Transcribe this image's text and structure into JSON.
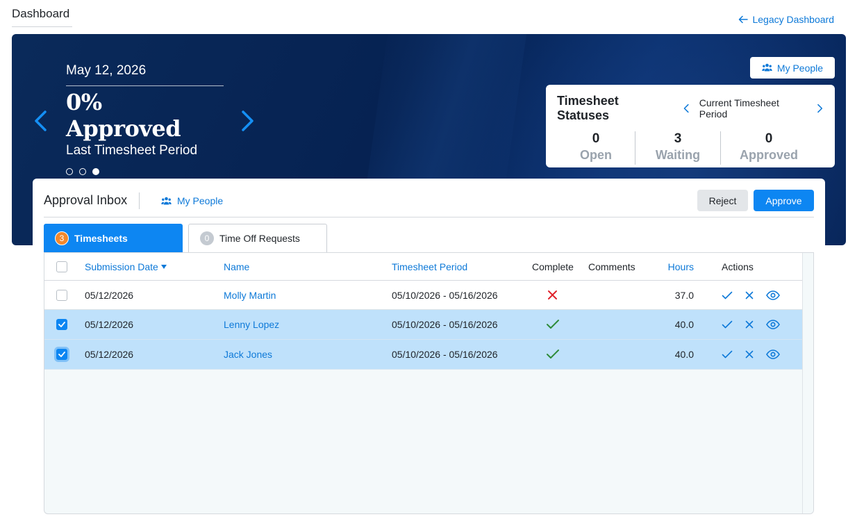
{
  "page": {
    "title": "Dashboard",
    "legacy_link": "Legacy Dashboard"
  },
  "banner": {
    "date": "May 12, 2026",
    "metric": "0% Approved",
    "caption": "Last Timesheet Period",
    "dots_count": 3,
    "active_dot": 3,
    "my_people_label": "My People"
  },
  "status_card": {
    "title": "Timesheet Statuses",
    "period_label": "Current Timesheet Period",
    "stats": [
      {
        "value": "0",
        "label": "Open"
      },
      {
        "value": "3",
        "label": "Waiting"
      },
      {
        "value": "0",
        "label": "Approved"
      }
    ]
  },
  "inbox": {
    "title": "Approval Inbox",
    "my_people_label": "My People",
    "reject_label": "Reject",
    "approve_label": "Approve",
    "tabs": [
      {
        "label": "Timesheets",
        "count": "3",
        "active": true
      },
      {
        "label": "Time Off Requests",
        "count": "0",
        "active": false
      }
    ],
    "columns": {
      "submission_date": "Submission Date",
      "name": "Name",
      "period": "Timesheet Period",
      "complete": "Complete",
      "comments": "Comments",
      "hours": "Hours",
      "actions": "Actions"
    },
    "rows": [
      {
        "date": "05/12/2026",
        "name": "Molly Martin",
        "period": "05/10/2026 - 05/16/2026",
        "complete": "incomplete",
        "comments": "",
        "hours": "37.0",
        "checked": false
      },
      {
        "date": "05/12/2026",
        "name": "Lenny Lopez",
        "period": "05/10/2026 - 05/16/2026",
        "complete": "complete",
        "comments": "",
        "hours": "40.0",
        "checked": true
      },
      {
        "date": "05/12/2026",
        "name": "Jack Jones",
        "period": "05/10/2026 - 05/16/2026",
        "complete": "complete",
        "comments": "",
        "hours": "40.0",
        "checked": true
      }
    ]
  },
  "colors": {
    "accent": "#0d86f2",
    "link": "#0d79d8",
    "banner_bg": "#062252",
    "selected_row": "#bfe1fb",
    "badge_orange": "#f3882c",
    "complete_green": "#2e8b3a",
    "incomplete_red": "#e0222b"
  },
  "icons": {
    "back_arrow": "arrow-left-icon",
    "people": "people-icon",
    "prev": "chevron-left-icon",
    "next": "chevron-right-icon",
    "approve_row": "check-icon",
    "reject_row": "close-icon",
    "view_row": "eye-icon"
  }
}
